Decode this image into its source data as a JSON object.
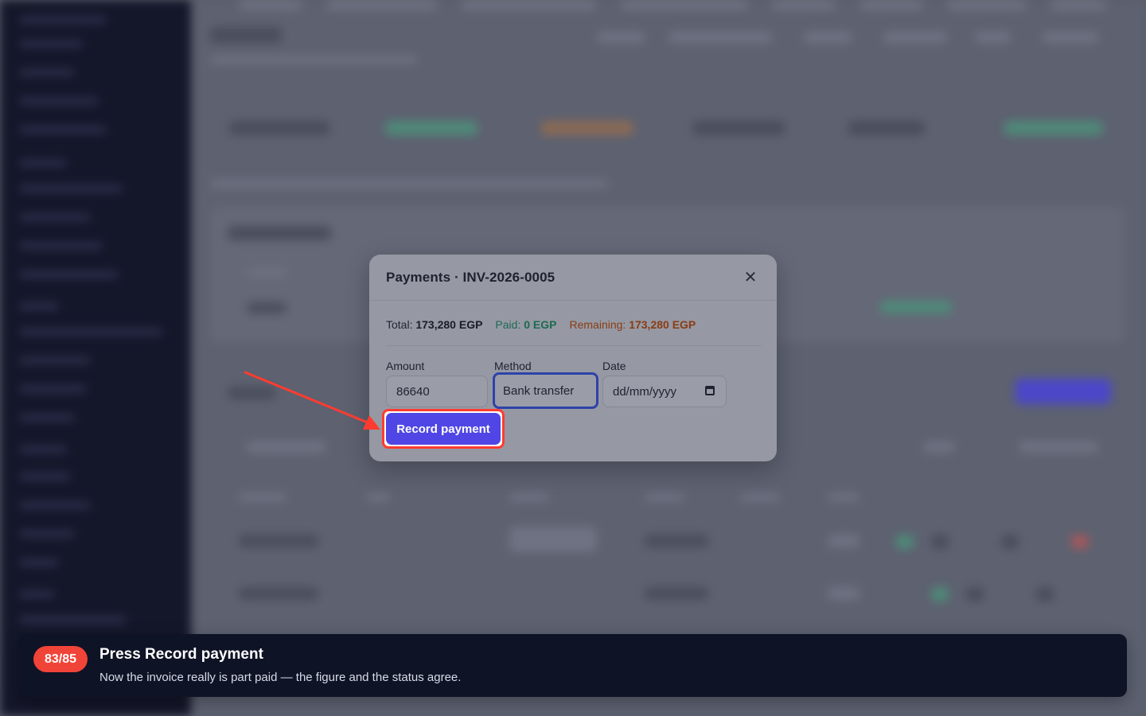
{
  "modal": {
    "title": "Payments · INV-2026-0005",
    "summary": {
      "total_label": "Total:",
      "total_value": "173,280 EGP",
      "paid_label": "Paid:",
      "paid_value": "0 EGP",
      "remaining_label": "Remaining:",
      "remaining_value": "173,280 EGP"
    },
    "form": {
      "amount_label": "Amount",
      "amount_value": "86640",
      "method_label": "Method",
      "method_value": "Bank transfer",
      "date_label": "Date",
      "date_placeholder": "dd/mm/yyyy"
    },
    "record_button": "Record payment"
  },
  "tutorial": {
    "step": "83/85",
    "title": "Press Record payment",
    "description": "Now the invoice really is part paid — the figure and the status agree."
  },
  "colors": {
    "accent": "#4f46e5",
    "highlight": "#ff3b30",
    "paid": "#1c6a50",
    "remaining": "#8a3c12",
    "toast_bg": "#0f1326"
  },
  "icons": [
    "close-icon",
    "calendar-icon",
    "arrow-pointer-icon"
  ]
}
